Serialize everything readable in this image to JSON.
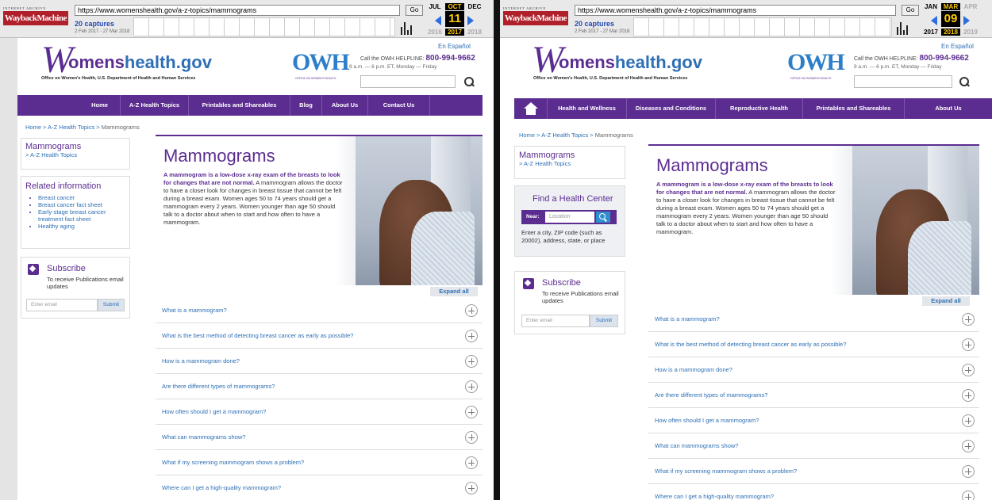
{
  "left": {
    "wayback": {
      "url": "https://www.womenshealth.gov/a-z-topics/mammograms",
      "go": "Go",
      "captures": "20 captures",
      "range": "2 Feb 2017 - 27 Mar 2018",
      "months": [
        "JUL",
        "OCT",
        "DEC"
      ],
      "day": "11",
      "years": [
        "2016",
        "2017",
        "2018"
      ]
    },
    "header": {
      "logo_w": "W",
      "logo_text_a": "omens",
      "logo_text_b": "health.gov",
      "logo_sub": "Office on Women's Health, U.S. Department of Health and Human Services",
      "owh": "OWH",
      "owh_sub": "OFFICE ON WOMEN'S HEALTH",
      "espanol": "En Español",
      "helpline_label": "Call the OWH HELPLINE:",
      "helpline_number": "800-994-9662",
      "hours": "9 a.m. — 6 p.m. ET, Monday — Friday"
    },
    "nav": [
      "Home",
      "A-Z Health Topics",
      "Printables and Shareables",
      "Blog",
      "About Us",
      "Contact Us"
    ],
    "breadcrumb": {
      "home": "Home",
      "sep1": " > ",
      "topics": "A-Z Health Topics",
      "sep2": " > ",
      "current": "Mammograms"
    },
    "sidebar": {
      "title": "Mammograms",
      "link": "> A-Z Health Topics",
      "related_title": "Related information",
      "related": [
        "Breast cancer",
        "Breast cancer fact sheet",
        "Early-stage breast cancer treatment fact sheet",
        "Healthy aging"
      ],
      "subscribe_title": "Subscribe",
      "subscribe_text": "To receive Publications email updates",
      "email_placeholder": "Enter email",
      "submit": "Submit"
    },
    "hero": {
      "title": "Mammograms",
      "lead_bold": "A mammogram is a low-dose x-ray exam of the breasts to look for changes that are not normal.",
      "lead_rest": " A mammogram allows the doctor to have a closer look for changes in breast tissue that cannot be felt during a breast exam. Women ages 50 to 74 years should get a mammogram every 2 years. Women younger than age 50 should talk to a doctor about when to start and how often to have a mammogram."
    },
    "expand_all": "Expand all",
    "faq": [
      "What is a mammogram?",
      "What is the best method of detecting breast cancer as early as possible?",
      "How is a mammogram done?",
      "Are there different types of mammograms?",
      "How often should I get a mammogram?",
      "What can mammograms show?",
      "What if my screening mammogram shows a problem?",
      "Where can I get a high-quality mammogram?"
    ]
  },
  "right": {
    "wayback": {
      "url": "https://www.womenshealth.gov/a-z-topics/mammograms",
      "go": "Go",
      "captures": "20 captures",
      "range": "2 Feb 2017 - 27 Mar 2018",
      "months": [
        "JAN",
        "MAR",
        "APR"
      ],
      "day": "09",
      "years": [
        "2017",
        "2018",
        "2019"
      ]
    },
    "header": {
      "logo_w": "W",
      "logo_text_a": "omens",
      "logo_text_b": "health.gov",
      "logo_sub": "Office on Women's Health, U.S. Department of Health and Human Services",
      "owh": "OWH",
      "owh_sub": "OFFICE ON WOMEN'S HEALTH",
      "espanol": "En Español",
      "helpline_label": "Call the OWH HELPLINE:",
      "helpline_number": "800-994-9662",
      "hours": "9 a.m. — 6 p.m. ET, Monday — Friday"
    },
    "nav": [
      "Health and Wellness",
      "Diseases and Conditions",
      "Reproductive Health",
      "Printables and Shareables",
      "About Us"
    ],
    "breadcrumb": {
      "home": "Home",
      "sep1": " > ",
      "topics": "A-Z Health Topics",
      "sep2": " > ",
      "current": "Mammograms"
    },
    "sidebar": {
      "title": "Mammograms",
      "link": "> A-Z Health Topics",
      "hc_title": "Find a Health Center",
      "hc_near": "Near:",
      "hc_placeholder": "Location",
      "hc_text": "Enter a city, ZIP code (such as 20002), address, state, or place",
      "subscribe_title": "Subscribe",
      "subscribe_text": "To receive Publications email updates",
      "email_placeholder": "Enter email",
      "submit": "Submit"
    },
    "hero": {
      "title": "Mammograms",
      "lead_bold": "A mammogram is a low-dose x-ray exam of the breasts to look for changes that are not normal.",
      "lead_rest": " A mammogram allows the doctor to have a closer look for changes in breast tissue that cannot be felt during a breast exam. Women ages 50 to 74 years should get a mammogram every 2 years. Women younger than age 50 should talk to a doctor about when to start and how often to have a mammogram."
    },
    "expand_all": "Expand all",
    "faq": [
      "What is a mammogram?",
      "What is the best method of detecting breast cancer as early as possible?",
      "How is a mammogram done?",
      "Are there different types of mammograms?",
      "How often should I get a mammogram?",
      "What can mammograms show?",
      "What if my screening mammogram shows a problem?",
      "Where can I get a high-quality mammogram?"
    ]
  }
}
